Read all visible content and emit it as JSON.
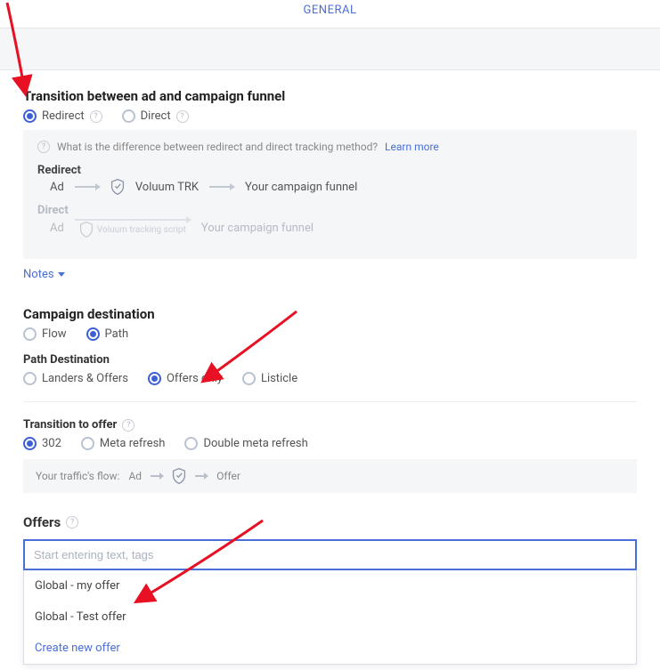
{
  "tabs": {
    "general": "GENERAL"
  },
  "transition": {
    "title": "Transition between ad and campaign funnel",
    "options": {
      "redirect": "Redirect",
      "direct": "Direct"
    },
    "info_q": "What is the difference between redirect and direct tracking method?",
    "learn_more": "Learn more",
    "redirect_label": "Redirect",
    "direct_label": "Direct",
    "ad": "Ad",
    "voluum_trk": "Voluum TRK",
    "funnel": "Your campaign funnel",
    "script": "Voluum tracking script"
  },
  "notes": "Notes",
  "destination": {
    "title": "Campaign destination",
    "flow": "Flow",
    "path": "Path",
    "path_dest_label": "Path Destination",
    "landers_offers": "Landers & Offers",
    "offers_only": "Offers only",
    "listicle": "Listicle"
  },
  "transition_offer": {
    "title": "Transition to offer",
    "o302": "302",
    "meta": "Meta refresh",
    "double_meta": "Double meta refresh",
    "flow_label": "Your traffic's flow:",
    "ad": "Ad",
    "offer": "Offer"
  },
  "offers": {
    "title": "Offers",
    "placeholder": "Start entering text, tags",
    "items": [
      "Global - my offer",
      "Global - Test offer"
    ],
    "create": "Create new offer"
  }
}
